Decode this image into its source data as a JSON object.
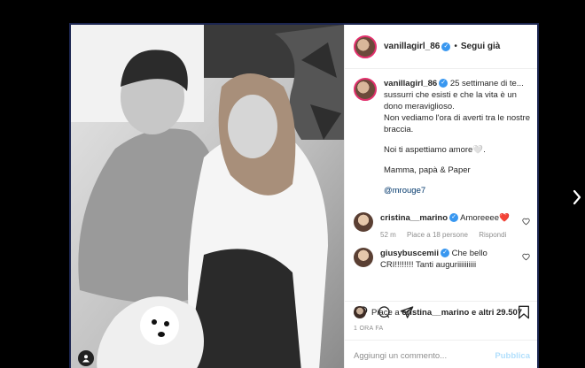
{
  "post": {
    "username": "vanillagirl_86",
    "follow_label": "Segui già",
    "caption_lines": [
      "25 settimane di te... sussurri che esisti e che la vita è un dono meraviglioso.",
      "Non vediamo l'ora di averti tra le nostre braccia.",
      "Noi ti aspettiamo amore🤍.",
      "Mamma, papà & Paper"
    ],
    "mention": "@mrouge7"
  },
  "comments": [
    {
      "username": "cristina__marino",
      "text": "Amoreeee❤️",
      "time": "52 m",
      "likes": "Piace a 18 persone",
      "reply": "Rispondi"
    },
    {
      "username": "giusybuscemii",
      "text": "Che bello CRI!!!!!!!! Tanti auguriiiiiiiiii"
    }
  ],
  "likes": {
    "prefix": "Piace a",
    "user": "cristina__marino",
    "suffix": "e altri 29.507"
  },
  "timestamp": "1 ORA FA",
  "add_comment": {
    "placeholder": "Aggiungi un commento...",
    "post_label": "Pubblica"
  },
  "colors": {
    "background": "#000000",
    "frame_border": "#1b2550",
    "verified": "#3897f0",
    "post_button": "#b2dffc"
  }
}
